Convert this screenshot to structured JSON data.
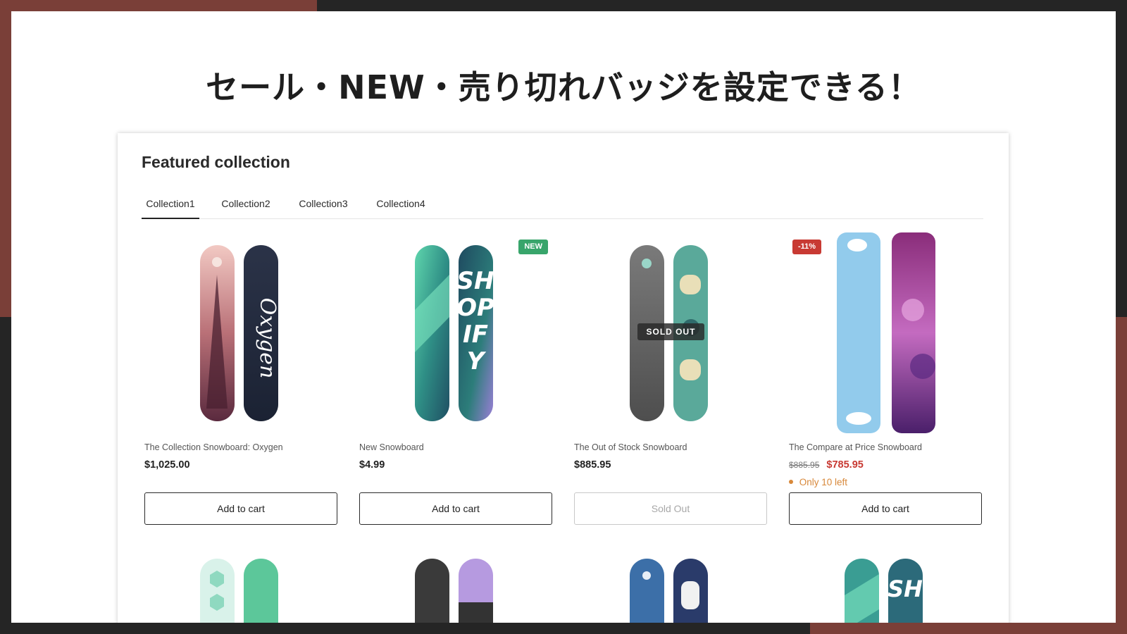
{
  "headline": "セール・NEW・売り切れバッジを設定できる！",
  "section": {
    "title": "Featured collection",
    "tabs": [
      {
        "label": "Collection1",
        "active": true
      },
      {
        "label": "Collection2",
        "active": false
      },
      {
        "label": "Collection3",
        "active": false
      },
      {
        "label": "Collection4",
        "active": false
      }
    ]
  },
  "products": [
    {
      "name": "The Collection Snowboard: Oxygen",
      "price": "$1,025.00",
      "button": "Add to cart"
    },
    {
      "name": "New Snowboard",
      "price": "$4.99",
      "badge": "NEW",
      "button": "Add to cart"
    },
    {
      "name": "The Out of Stock Snowboard",
      "price": "$885.95",
      "badge": "SOLD OUT",
      "button": "Sold Out"
    },
    {
      "name": "The Compare at Price Snowboard",
      "compare_price": "$885.95",
      "price": "$785.95",
      "badge": "-11%",
      "stock": "Only 10 left",
      "button": "Add to cart"
    }
  ],
  "colors": {
    "frame_accent": "#7a3f38",
    "badge_new": "#38a56b",
    "badge_sale": "#c83a33",
    "stock_warning": "#d8883a"
  }
}
